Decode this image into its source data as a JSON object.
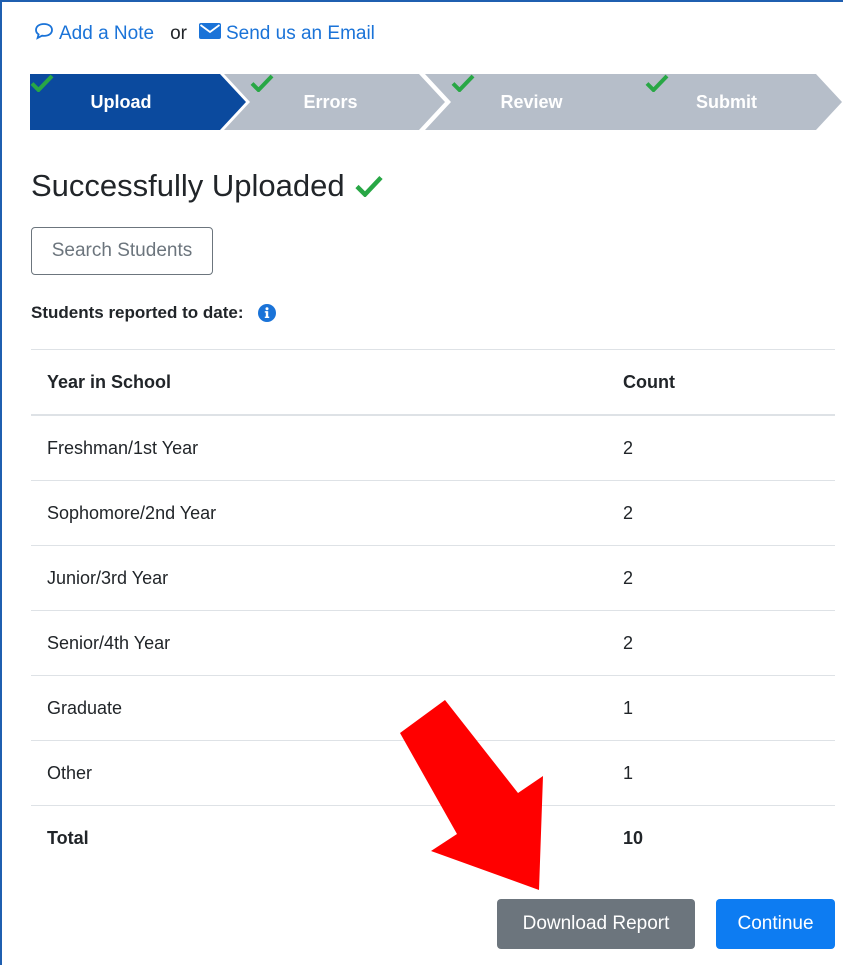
{
  "contact": {
    "add_note_label": "Add a Note",
    "or_label": "or",
    "email_label": "Send us an Email"
  },
  "steps": [
    {
      "label": "Upload",
      "state": "active"
    },
    {
      "label": "Errors",
      "state": "done"
    },
    {
      "label": "Review",
      "state": "done"
    },
    {
      "label": "Submit",
      "state": "done"
    }
  ],
  "page": {
    "heading": "Successfully Uploaded",
    "search_button": "Search Students",
    "reported_label": "Students reported to date:"
  },
  "table": {
    "headers": {
      "year": "Year in School",
      "count": "Count"
    },
    "rows": [
      {
        "year": "Freshman/1st Year",
        "count": "2"
      },
      {
        "year": "Sophomore/2nd Year",
        "count": "2"
      },
      {
        "year": "Junior/3rd Year",
        "count": "2"
      },
      {
        "year": "Senior/4th Year",
        "count": "2"
      },
      {
        "year": "Graduate",
        "count": "1"
      },
      {
        "year": "Other",
        "count": "1"
      }
    ],
    "total": {
      "label": "Total",
      "count": "10"
    }
  },
  "buttons": {
    "download": "Download Report",
    "continue": "Continue"
  },
  "colors": {
    "step_active": "#0b4a9e",
    "step_inactive": "#b6bec9",
    "check_green": "#28a745",
    "link_blue": "#1a73d8",
    "download_gray": "#6c757d",
    "continue_blue": "#0d7cf2",
    "annotation_arrow": "#ff0000"
  },
  "icons": {
    "note": "speech-bubble-icon",
    "email": "envelope-icon",
    "check": "check-icon",
    "info": "info-circle-icon"
  }
}
